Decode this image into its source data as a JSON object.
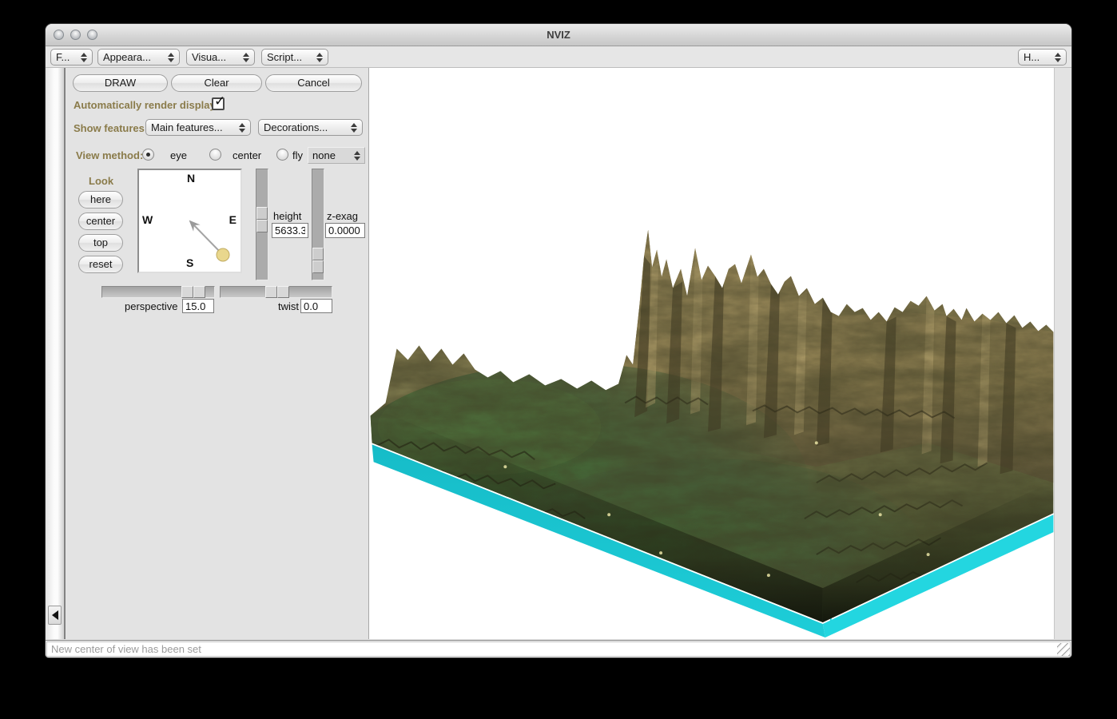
{
  "window": {
    "title": "NVIZ"
  },
  "menubar": {
    "items": [
      {
        "label": "F..."
      },
      {
        "label": "Appeara..."
      },
      {
        "label": "Visua..."
      },
      {
        "label": "Script..."
      }
    ],
    "help": {
      "label": "H..."
    }
  },
  "toolbar": {
    "draw": "DRAW",
    "clear": "Clear",
    "cancel": "Cancel"
  },
  "options": {
    "auto_render_label": "Automatically render display:",
    "auto_render_checked": "true",
    "show_features_label": "Show features:",
    "main_features_label": "Main features...",
    "decorations_label": "Decorations...",
    "view_method_label": "View method:",
    "view_methods": [
      {
        "label": "eye",
        "selected": true
      },
      {
        "label": "center",
        "selected": false
      },
      {
        "label": "fly",
        "selected": false
      }
    ],
    "fly_mode": "none"
  },
  "look": {
    "title": "Look",
    "buttons": [
      {
        "label": "here"
      },
      {
        "label": "center"
      },
      {
        "label": "top"
      },
      {
        "label": "reset"
      }
    ],
    "compass": {
      "n": "N",
      "s": "S",
      "e": "E",
      "w": "W"
    }
  },
  "sliders": {
    "height": {
      "label": "height",
      "value": "5633.3"
    },
    "zexag": {
      "label": "z-exag",
      "value": "0.0000"
    },
    "perspective": {
      "label": "perspective",
      "value": "15.0"
    },
    "twist": {
      "label": "twist",
      "value": "0.0"
    }
  },
  "statusbar": {
    "message": "New center of view has been set"
  },
  "colors": {
    "base_plane_cyan": "#1ecdd8",
    "label_olive": "#8a7b4a"
  }
}
